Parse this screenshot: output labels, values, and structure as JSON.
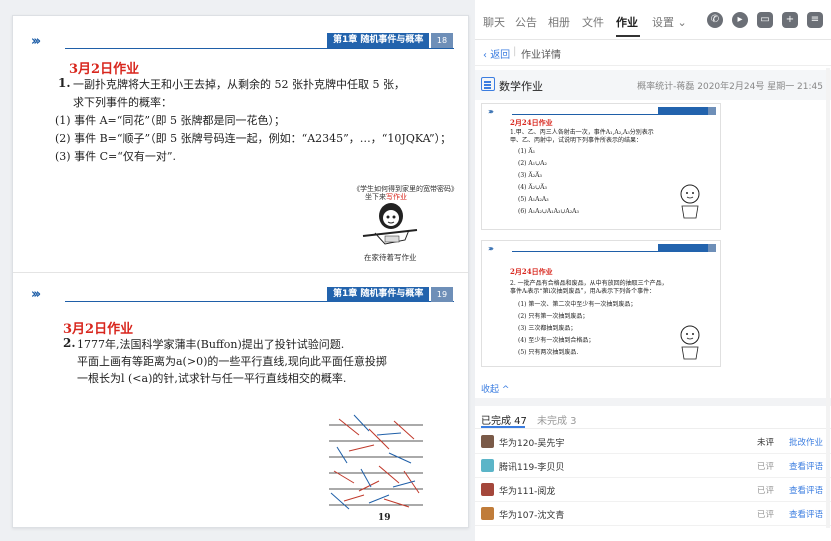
{
  "left_doc": {
    "slide1": {
      "chapter": "第1章 随机事件与概率",
      "page": "18",
      "hw_title": "3月2日作业",
      "q_num": "1.",
      "lines": [
        "一副扑克牌将大王和小王去掉，从剩余的 52 张扑克牌中任取 5 张，",
        "求下列事件的概率：",
        "(1) 事件 A=“同花”（即 5 张牌都是同一花色）；",
        "(2) 事件 B=“顺子”（即 5 张牌号码连一起，例如：“A2345”，…，“10JQKA”）；",
        "(3) 事件 C=“仅有一对”."
      ],
      "meme_caption1": "《学生如何得到家里的宽带密码》",
      "meme_caption2": "坐下来",
      "meme_caption2_red": "写作业",
      "meme_caption3": "在家待着写作业"
    },
    "slide2": {
      "chapter": "第1章 随机事件与概率",
      "page": "19",
      "hw_title": "3月2日作业",
      "q_num": "2.",
      "lines": [
        "1777年,法国科学家蒲丰(Buffon)提出了投针试验问题.",
        "平面上画有等距离为a(>0)的一些平行直线,现向此平面任意投掷",
        "一根长为l (<a)的针,试求针与任一平行直线相交的概率."
      ],
      "footer_page": "19"
    }
  },
  "tabs": [
    "聊天",
    "公告",
    "相册",
    "文件",
    "作业",
    "设置 ⌄"
  ],
  "toolbar_icons": [
    "phone-icon",
    "video-icon",
    "screen-icon",
    "add-chat-icon"
  ],
  "subbar": {
    "back": "返回",
    "title": "作业详情"
  },
  "homework": {
    "name": "数学作业",
    "meta": "概率统计-蒋磊 2020年2月24号 星期一 21:45"
  },
  "thumb1": {
    "title": "2月24日作业",
    "lines": [
      "1.甲、乙、丙三人各射击一次，事件A₁,A₂,A₃分别表示",
      "甲、乙、丙射中，试说明下列事件所表示的结果：",
      "(1) A̅₁",
      "(2) A₁∪A₂",
      "(3) A̅₂A̅₃",
      "(4) A̅₂∪A̅₃",
      "(5) A₁A₂A₃",
      "(6) A₁A₂∪A₁A₃∪A₂A₃"
    ]
  },
  "thumb2": {
    "title": "2月24日作业",
    "lines": [
      "2. 一批产品有合格品和废品，从中有放回的抽取三个产品，",
      "事件Aᵢ表示“第i次抽到废品”，用Aᵢ表示下列各个事件：",
      "(1) 第一次、第二次中至少有一次抽到废品；",
      "(2) 只有第一次抽到废品；",
      "(3) 三次都抽到废品；",
      "(4) 至少有一次抽到合格品；",
      "(5) 只有两次抽到废品."
    ]
  },
  "collapse_label": "收起 ^",
  "status_tabs": {
    "done": "已完成 47",
    "undone": "未完成 3"
  },
  "students": [
    {
      "name": "华为120-吴先宇",
      "status": "未评",
      "action": "批改作业",
      "color": "#7a5a48"
    },
    {
      "name": "腾讯119-李贝贝",
      "status": "已评",
      "action": "查看评语",
      "color": "#5bb5c8"
    },
    {
      "name": "华为111-阅龙",
      "status": "已评",
      "action": "查看评语",
      "color": "#a4473b"
    },
    {
      "name": "华为107-沈文青",
      "status": "已评",
      "action": "查看评语",
      "color": "#c07c3a"
    }
  ]
}
